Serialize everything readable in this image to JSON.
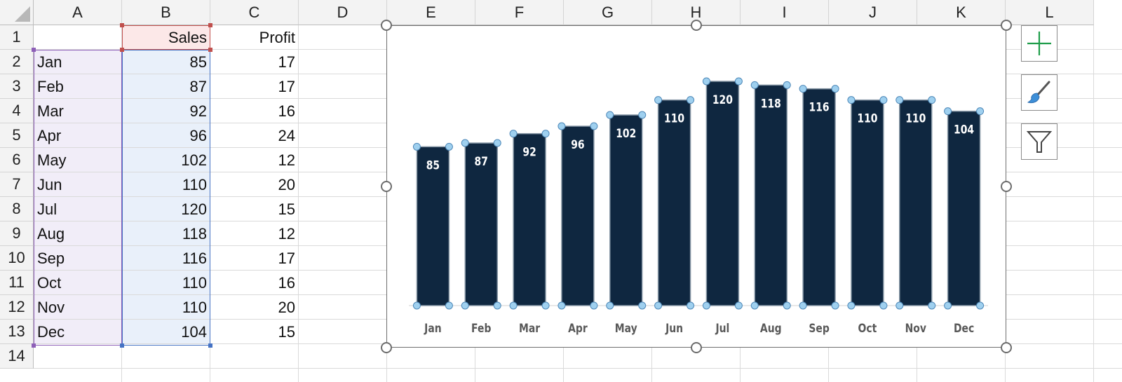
{
  "columns": [
    "A",
    "B",
    "C",
    "D",
    "E",
    "F",
    "G",
    "H",
    "I",
    "J",
    "K",
    "L"
  ],
  "rows": [
    "1",
    "2",
    "3",
    "4",
    "5",
    "6",
    "7",
    "8",
    "9",
    "10",
    "11",
    "12",
    "13",
    "14"
  ],
  "table": {
    "header_sales": "Sales",
    "header_profit": "Profit",
    "months": [
      "Jan",
      "Feb",
      "Mar",
      "Apr",
      "May",
      "Jun",
      "Jul",
      "Aug",
      "Sep",
      "Oct",
      "Nov",
      "Dec"
    ],
    "sales": [
      "85",
      "87",
      "92",
      "96",
      "102",
      "110",
      "120",
      "118",
      "116",
      "110",
      "110",
      "104"
    ],
    "profit": [
      "17",
      "17",
      "16",
      "24",
      "12",
      "20",
      "15",
      "12",
      "17",
      "16",
      "20",
      "15"
    ]
  },
  "chart_data": {
    "type": "bar",
    "categories": [
      "Jan",
      "Feb",
      "Mar",
      "Apr",
      "May",
      "Jun",
      "Jul",
      "Aug",
      "Sep",
      "Oct",
      "Nov",
      "Dec"
    ],
    "values": [
      85,
      87,
      92,
      96,
      102,
      110,
      120,
      118,
      116,
      110,
      110,
      104
    ],
    "data_labels": [
      "85",
      "87",
      "92",
      "96",
      "102",
      "110",
      "120",
      "118",
      "116",
      "110",
      "110",
      "104"
    ],
    "title": "",
    "xlabel": "",
    "ylabel": "",
    "ylim": [
      0,
      120
    ],
    "grid": false,
    "legend": "none",
    "selected_series": true
  },
  "colors": {
    "bar": "#0f2740",
    "selection_handle": "#9fd0ef",
    "sales_highlight": "#e9f0fa",
    "month_highlight": "#f1edf8",
    "header_highlight": "#fce8e8",
    "plus_icon": "#1f9d4a"
  },
  "chart_buttons": {
    "elements_icon": "plus-icon",
    "styles_icon": "paintbrush-icon",
    "filters_icon": "funnel-icon"
  }
}
